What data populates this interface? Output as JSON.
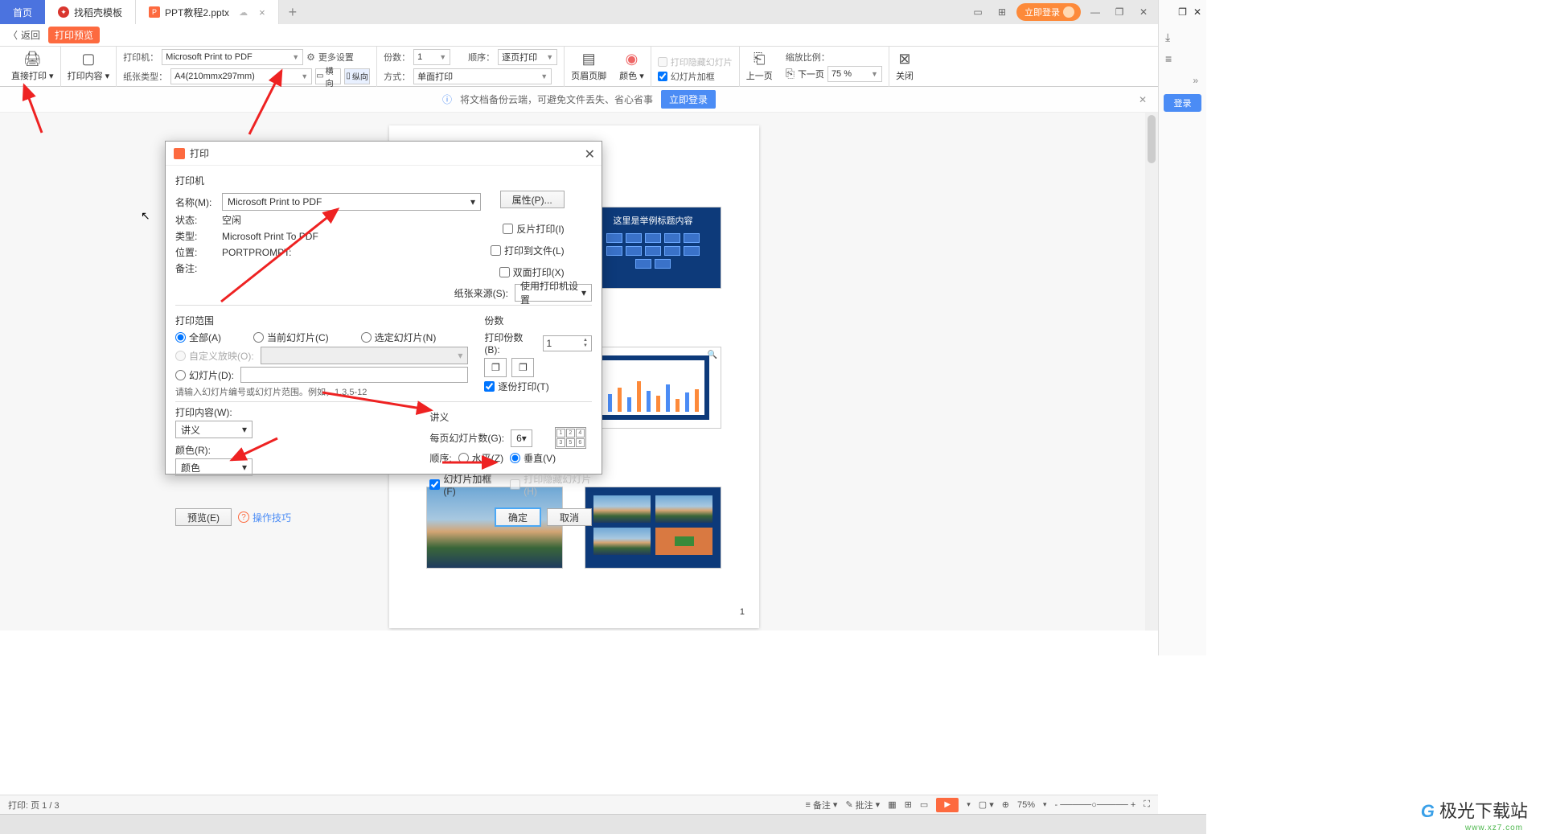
{
  "tabs": {
    "home": "首页",
    "t1": "找稻壳模板",
    "t2": "PPT教程2.pptx"
  },
  "titlebar": {
    "login": "立即登录"
  },
  "row2": {
    "back": "返回",
    "preview": "打印预览"
  },
  "ribbon": {
    "direct_print": "直接打印",
    "print_content": "打印内容",
    "printer_lbl": "打印机：",
    "printer_val": "Microsoft Print to PDF",
    "paper_lbl": "纸张类型：",
    "paper_val": "A4(210mmx297mm)",
    "settings_gear": "更多设置",
    "landscape": "横向",
    "portrait": "纵向",
    "copies_lbl": "份数：",
    "copies_val": "1",
    "order_lbl": "顺序：",
    "order_val": "逐页打印",
    "mode_lbl": "方式：",
    "mode_val": "单面打印",
    "header_footer": "页眉页脚",
    "color": "颜色",
    "hidden_slide": "打印隐藏幻灯片",
    "slide_frame": "幻灯片加框",
    "prev_page": "上一页",
    "next_page": "下一页",
    "zoom_lbl": "缩放比例：",
    "zoom_val": "75 %",
    "close": "关闭"
  },
  "banner": {
    "text": "将文档备份云端，可避免文件丢失、省心省事",
    "login": "立即登录"
  },
  "page": {
    "slide1_title": "这里是举例标题内容",
    "page_num": "1"
  },
  "dialog": {
    "title": "打印",
    "printer_section": "打印机",
    "name_lbl": "名称(M):",
    "name_val": "Microsoft Print to PDF",
    "props_btn": "属性(P)...",
    "status_lbl": "状态:",
    "status_val": "空闲",
    "type_lbl": "类型:",
    "type_val": "Microsoft Print To PDF",
    "pos_lbl": "位置:",
    "pos_val": "PORTPROMPT:",
    "remark_lbl": "备注:",
    "reverse": "反片打印(I)",
    "to_file": "打印到文件(L)",
    "duplex": "双面打印(X)",
    "paper_src_lbl": "纸张来源(S):",
    "paper_src_val": "使用打印机设置",
    "range_section": "打印范围",
    "range_all": "全部(A)",
    "range_current": "当前幻灯片(C)",
    "range_selected": "选定幻灯片(N)",
    "range_custom": "自定义放映(O):",
    "range_slides": "幻灯片(D):",
    "range_hint": "请输入幻灯片编号或幻灯片范围。例如，1,3,5-12",
    "copies_section": "份数",
    "copies_count_lbl": "打印份数(B):",
    "copies_count_val": "1",
    "collate": "逐份打印(T)",
    "content_lbl": "打印内容(W):",
    "content_val": "讲义",
    "color_lbl": "颜色(R):",
    "color_val": "颜色",
    "handout_section": "讲义",
    "per_page_lbl": "每页幻灯片数(G):",
    "per_page_val": "6",
    "order_lbl2": "顺序:",
    "order_h": "水平(Z)",
    "order_v": "垂直(V)",
    "frame": "幻灯片加框(F)",
    "hidden": "打印隐藏幻灯片(H)",
    "preview_btn": "预览(E)",
    "tips_link": "操作技巧",
    "ok": "确定",
    "cancel": "取消"
  },
  "statusbar": {
    "page": "打印: 页 1 / 3",
    "remark": "备注",
    "annot": "批注",
    "zoom": "75%"
  },
  "rstrip": {
    "login": "登录"
  },
  "watermark": {
    "brand": "极光下载站",
    "url": "www.xz7.com"
  }
}
